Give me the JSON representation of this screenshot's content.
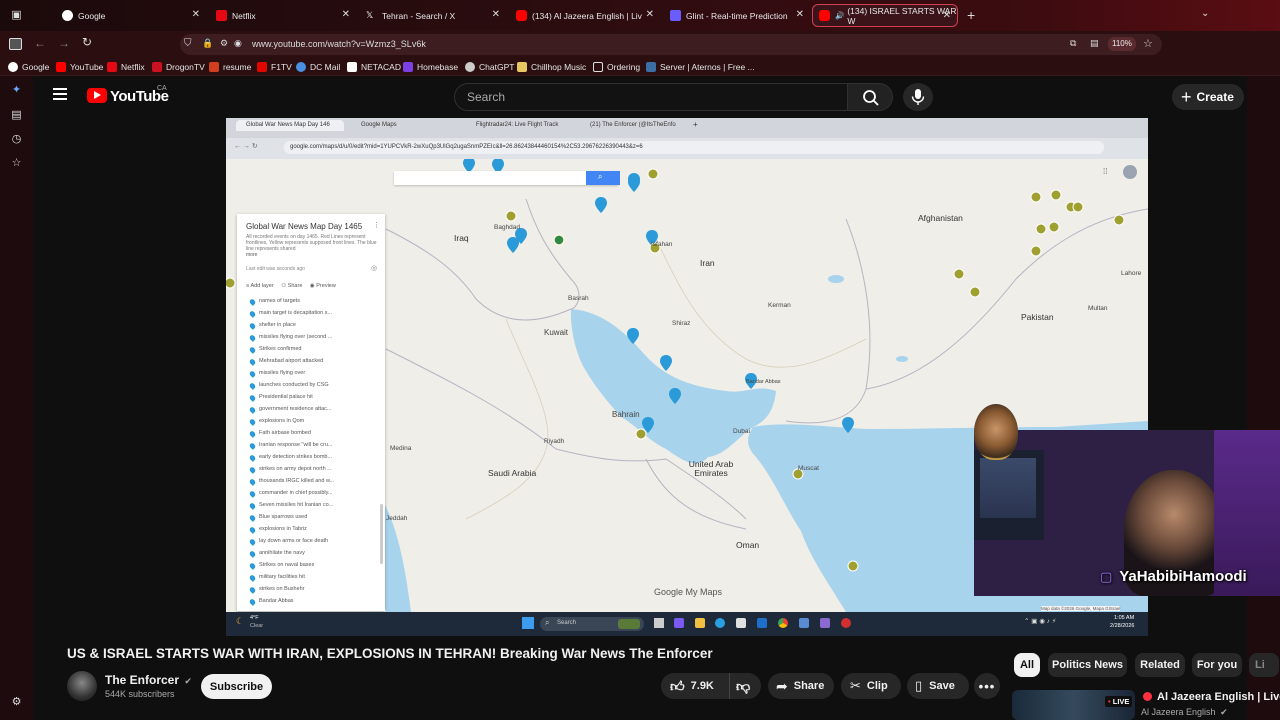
{
  "browser": {
    "tabs": [
      {
        "label": "Google",
        "color": "#4285f4"
      },
      {
        "label": "Netflix",
        "color": "#e50914"
      },
      {
        "label": "Tehran - Search / X",
        "color": "#ffffff"
      },
      {
        "label": "(134) Al Jazeera English | Liv",
        "color": "#ff0000"
      },
      {
        "label": "Glint - Real-time Prediction",
        "color": "#6a5cff"
      },
      {
        "label": "(134) ISRAEL STARTS WAR W",
        "color": "#ff0000"
      }
    ],
    "url": "www.youtube.com/watch?v=Wzmz3_SLv6k",
    "zoom": "110%",
    "bookmarks": [
      "Google",
      "YouTube",
      "Netflix",
      "DrogonTV",
      "resume",
      "F1TV",
      "DC Mail",
      "NETACAD",
      "Homebase",
      "ChatGPT",
      "Chillhop Music",
      "Ordering",
      "Server | Aternos | Free ..."
    ]
  },
  "youtube": {
    "logo_text": "YouTube",
    "region": "CA",
    "search_placeholder": "Search",
    "create_label": "Create"
  },
  "video": {
    "inner_tabs": [
      "Global War News Map Day 146",
      "Google Maps",
      "Flightradar24: Live Flight Track",
      "(21) The Enforcer (@ItsTheEnfo"
    ],
    "inner_url": "google.com/maps/d/u/0/edit?mid=1YUPCVkR-2wXuQp3UlGq2ugaSnmPZEIc&ll=26.86243844460154%2C53.29676226390443&z=6",
    "map_title": "Global War News Map Day 1465",
    "map_desc": "All recorded events on day 1465. Red Lines represent frontlines, Yellow represents supposed front lines. The blue line represents shared",
    "map_more": "more",
    "map_edit": "Last edit was seconds ago",
    "map_buttons": [
      "Add layer",
      "Share",
      "Preview"
    ],
    "layers": [
      "names of targets",
      "main target is decapitation s...",
      "shelter in place",
      "missiles flying over (second ...",
      "Strikes confirmed",
      "Mehrabad airport attacked",
      "missiles flying over",
      "launches conducted by CSG",
      "Presidential palace hit",
      "government residence attac...",
      "explosions in Qom",
      "Fath airbase bombed",
      "Iranian response \"will be cru...",
      "early detection strikes bomb...",
      "strikes on army depot north ...",
      "thousands IRGC killed and w...",
      "commander in chief possibly...",
      "Seven missiles hit Iranian co...",
      "Blue sparrows used",
      "explosions in Tabriz",
      "lay down arms or face death",
      "annihilate the navy",
      "Strikes on naval bases",
      "military facilities hit",
      "strikes on Bushehr",
      "Bandar Abbas"
    ],
    "map_labels": {
      "iraq": "Iraq",
      "iran": "Iran",
      "afghanistan": "Afghanistan",
      "pakistan": "Pakistan",
      "kuwait": "Kuwait",
      "bahrain": "Bahrain",
      "saudi": "Saudi Arabia",
      "uae": "United Arab\nEmirates",
      "oman": "Oman",
      "baghdad": "Baghdad",
      "basrah": "Basrah",
      "shiraz": "Shiraz",
      "riyadh": "Riyadh",
      "medina": "Medina",
      "jeddah": "Jeddah",
      "muscat": "Muscat",
      "dubai": "Dubai",
      "isfahan": "Isfahan",
      "multan": "Multan",
      "lahore": "Lahore",
      "kerman": "Kerman",
      "bandar_abbas": "Bandar Abbas"
    },
    "map_footer": "Google My Maps",
    "map_attrib": "Map data ©2026 Google, Mapa GISrael",
    "weather_temp": "4°F",
    "weather_desc": "Clear",
    "taskbar_search": "Search",
    "clock_time": "1:05 AM",
    "clock_date": "2/28/2026",
    "streamer": "YaHabibiHamoodi"
  },
  "below": {
    "title": "US & ISRAEL STARTS WAR WITH IRAN, EXPLOSIONS IN TEHRAN! Breaking War News The Enforcer",
    "channel": "The Enforcer",
    "subscribers": "544K subscribers",
    "subscribe": "Subscribe",
    "likes": "7.9K",
    "share": "Share",
    "clip": "Clip",
    "save": "Save",
    "chips": [
      "All",
      "Politics News",
      "Related",
      "For you",
      "Li"
    ],
    "related_title": "Al Jazeera English | Live",
    "related_channel": "Al Jazeera English",
    "live_badge": "LIVE"
  }
}
